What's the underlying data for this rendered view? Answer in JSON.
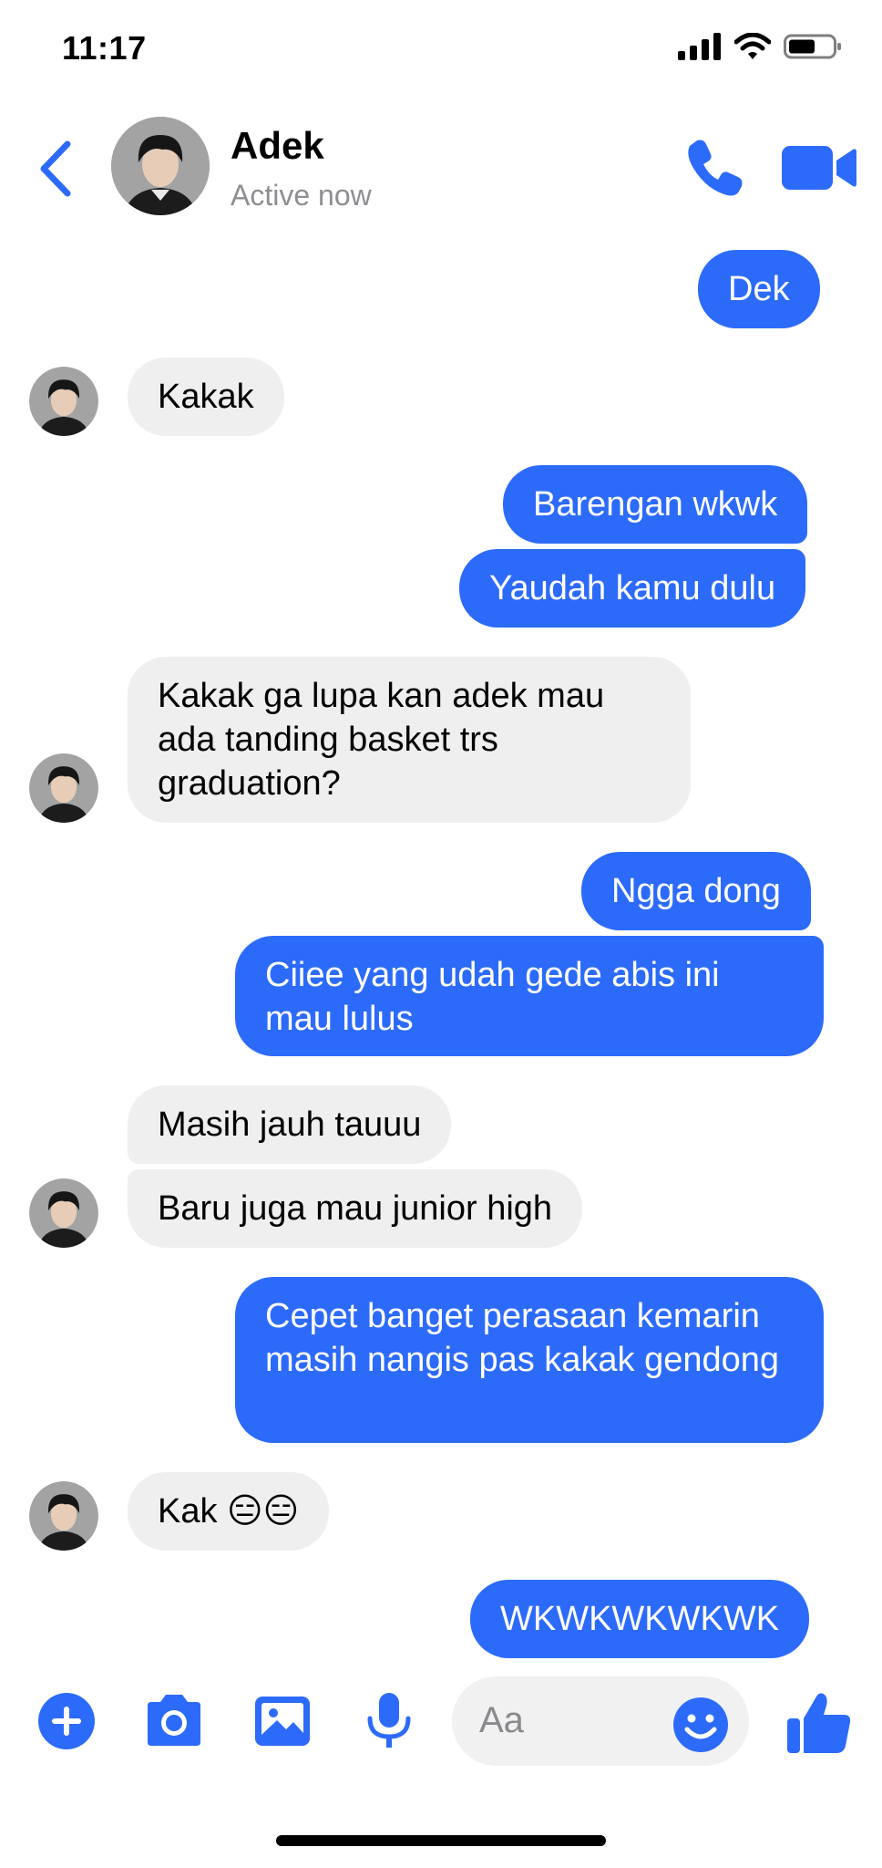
{
  "status_bar": {
    "time": "11:17"
  },
  "header": {
    "contact_name": "Adek",
    "contact_status": "Active now"
  },
  "messages": [
    {
      "side": "out",
      "text": "Dek"
    },
    {
      "side": "in",
      "text": "Kakak"
    },
    {
      "side": "out",
      "text": "Barengan wkwk"
    },
    {
      "side": "out",
      "text": "Yaudah kamu dulu"
    },
    {
      "side": "in",
      "text": "Kakak ga lupa kan adek mau ada tanding basket trs graduation?"
    },
    {
      "side": "out",
      "text": "Ngga dong"
    },
    {
      "side": "out",
      "text": "Ciiee yang udah gede abis ini mau lulus"
    },
    {
      "side": "in",
      "text": "Masih jauh tauuu"
    },
    {
      "side": "in",
      "text": "Baru juga mau junior high"
    },
    {
      "side": "out",
      "text": "Cepet banget perasaan kemarin masih nangis pas kakak gendong"
    },
    {
      "side": "in",
      "text": "Kak 😑😑"
    },
    {
      "side": "out",
      "text": "WKWKWKWKWK"
    }
  ],
  "composer": {
    "placeholder": "Aa"
  },
  "colors": {
    "accent": "#2c6bfa",
    "incoming_bubble": "#efefef"
  },
  "icons": [
    "back-chevron-icon",
    "phone-icon",
    "video-camera-icon",
    "plus-icon",
    "camera-icon",
    "gallery-icon",
    "microphone-icon",
    "emoji-icon",
    "thumbs-up-icon"
  ]
}
